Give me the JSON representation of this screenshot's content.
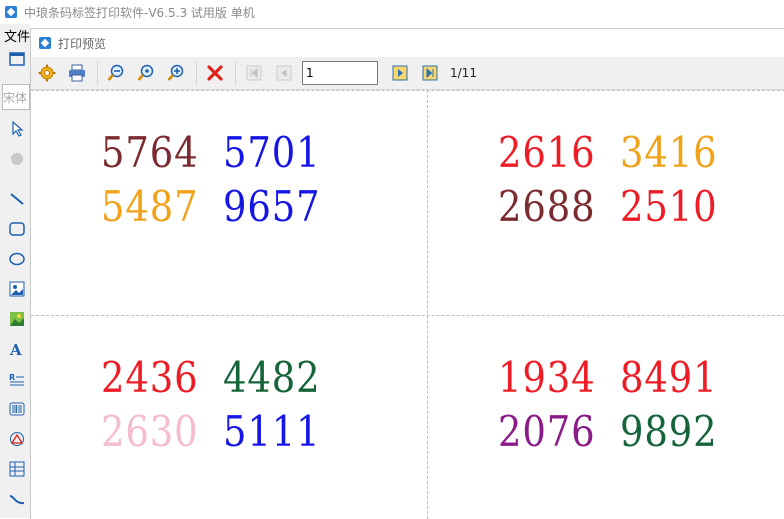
{
  "app": {
    "title": "中琅条码标签打印软件-V6.5.3 试用版 单机",
    "menu_file": "文件",
    "font_placeholder": "宋体"
  },
  "left_toolbar": {
    "icons": [
      "window-icon",
      "pointer-icon",
      "palette-icon",
      "line-icon",
      "rounded-rect-icon",
      "ellipse-icon",
      "image-icon",
      "picture-icon",
      "text-icon",
      "richtext-icon",
      "barcode-icon",
      "shape-icon",
      "table-icon",
      "curve-icon"
    ]
  },
  "dialog": {
    "title": "打印预览",
    "toolbar": {
      "settings_icon": "gear-icon",
      "print_icon": "printer-icon",
      "zoom_out_icon": "zoom-out-icon",
      "zoom_fit_icon": "zoom-fit-icon",
      "zoom_in_icon": "zoom-in-icon",
      "close_icon": "close-icon",
      "first_icon": "first-page-icon",
      "prev_icon": "prev-page-icon",
      "next_icon": "next-page-icon",
      "last_icon": "last-page-icon",
      "page_value": "1",
      "page_count": "1/11"
    },
    "labels": [
      {
        "numbers": [
          {
            "text": "5764",
            "color": "#7b2a2f"
          },
          {
            "text": "5701",
            "color": "#1515e6"
          },
          {
            "text": "5487",
            "color": "#f0a21a"
          },
          {
            "text": "9657",
            "color": "#1515e6"
          }
        ]
      },
      {
        "numbers": [
          {
            "text": "2616",
            "color": "#ee1c25"
          },
          {
            "text": "3416",
            "color": "#f0a21a"
          },
          {
            "text": "2688",
            "color": "#7b2a2f"
          },
          {
            "text": "2510",
            "color": "#ee1c25"
          }
        ]
      },
      {
        "numbers": [
          {
            "text": "2436",
            "color": "#ee1c25"
          },
          {
            "text": "4482",
            "color": "#16643a"
          },
          {
            "text": "2630",
            "color": "#f6bccb"
          },
          {
            "text": "5111",
            "color": "#1515e6"
          }
        ]
      },
      {
        "numbers": [
          {
            "text": "1934",
            "color": "#ee1c25"
          },
          {
            "text": "8491",
            "color": "#ee1c25"
          },
          {
            "text": "2076",
            "color": "#8a1b88"
          },
          {
            "text": "9892",
            "color": "#16643a"
          }
        ]
      }
    ]
  }
}
